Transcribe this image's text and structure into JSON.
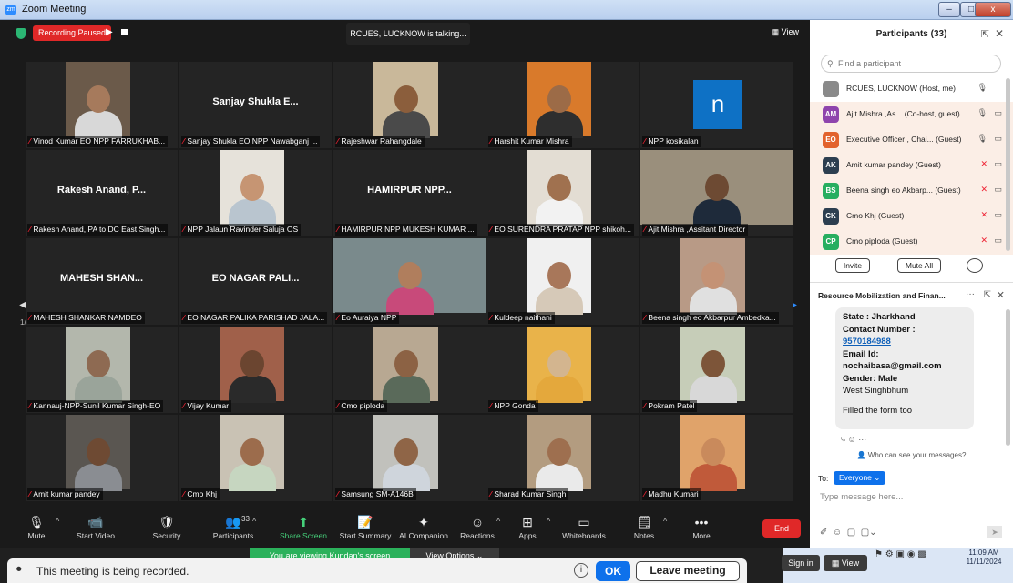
{
  "window": {
    "title": "Zoom Meeting",
    "min": "–",
    "max": "□",
    "close": "x"
  },
  "topbar": {
    "recording_status": "Recording Paused",
    "play": "▶",
    "talking": "RCUES, LUCKNOW is talking...",
    "view_label": "View"
  },
  "grid": {
    "page": "1/2",
    "tiles": [
      {
        "label": "Vinod Kumar EO NPP FARRUKHAB...",
        "big": "",
        "type": "cam",
        "skin": "#a67a5c",
        "shirt": "#d8d8d8",
        "bg": "#6b5a4a"
      },
      {
        "label": "Sanjay Shukla EO NPP Nawabganj ...",
        "big": "Sanjay Shukla E...",
        "type": "name"
      },
      {
        "label": "Rajeshwar Rahangdale",
        "big": "",
        "type": "cam",
        "skin": "#8b5e3c",
        "shirt": "#4a4a4a",
        "bg": "#c9b89a"
      },
      {
        "label": "Harshit Kumar Mishra",
        "big": "",
        "type": "cam",
        "skin": "#9c6b47",
        "shirt": "#2e2e2e",
        "bg": "#d97a2b"
      },
      {
        "label": "NPP kosikalan",
        "big": "n",
        "type": "logo"
      },
      {
        "label": "Rakesh Anand, PA to DC East Singh...",
        "big": "Rakesh Anand, P...",
        "type": "name"
      },
      {
        "label": "NPP Jalaun Ravinder Saluja OS",
        "big": "",
        "type": "cam",
        "skin": "#c69573",
        "shirt": "#b9c5cf",
        "bg": "#e6e2da"
      },
      {
        "label": "HAMIRPUR NPP MUKESH KUMAR ...",
        "big": "HAMIRPUR NPP...",
        "type": "name"
      },
      {
        "label": "EO SURENDRA PRATAP NPP shikoh...",
        "big": "",
        "type": "cam",
        "skin": "#a0714f",
        "shirt": "#f2f2f2",
        "bg": "#e3ddd3"
      },
      {
        "label": "Ajit Mishra ,Assitant Director",
        "big": "",
        "type": "wide",
        "skin": "#6d4a33",
        "shirt": "#1e2a3a",
        "bg": "#9a8f7c"
      },
      {
        "label": "MAHESH SHANKAR NAMDEO",
        "big": "MAHESH SHAN...",
        "type": "name"
      },
      {
        "label": "EO NAGAR PALIKA PARISHAD JALA...",
        "big": "EO NAGAR PALI...",
        "type": "name"
      },
      {
        "label": "Eo Auraiya NPP",
        "big": "",
        "type": "wide",
        "skin": "#b07e5d",
        "shirt": "#c84a7a",
        "bg": "#7a8a8c"
      },
      {
        "label": "Kuldeep naithani",
        "big": "",
        "type": "cam",
        "skin": "#a8775a",
        "shirt": "#d6c9b8",
        "bg": "#f0f0f0"
      },
      {
        "label": "Beena singh eo Akbarpur Ambedka...",
        "big": "",
        "type": "cam",
        "skin": "#c49275",
        "shirt": "#e0e0e0",
        "bg": "#b89a86"
      },
      {
        "label": "Kannauj-NPP-Sunil Kumar Singh-EO",
        "big": "",
        "type": "cam",
        "skin": "#8e6a52",
        "shirt": "#9aa49a",
        "bg": "#b3b7ac"
      },
      {
        "label": "Vijay Kumar",
        "big": "",
        "type": "cam",
        "skin": "#6b4530",
        "shirt": "#2a2a2a",
        "bg": "#a0604a"
      },
      {
        "label": "Cmo piploda",
        "big": "",
        "type": "cam",
        "skin": "#8c6244",
        "shirt": "#5a6a5a",
        "bg": "#b8a892"
      },
      {
        "label": "NPP Gonda",
        "big": "",
        "type": "cam",
        "skin": "#d3b58f",
        "shirt": "#e4a83c",
        "bg": "#e9b34a"
      },
      {
        "label": "Pokram Patel",
        "big": "",
        "type": "cam",
        "skin": "#7d5539",
        "shirt": "#d8d8d8",
        "bg": "#c6cdb8"
      },
      {
        "label": "Amit kumar pandey",
        "big": "",
        "type": "cam",
        "skin": "#6e4a33",
        "shirt": "#8a8d92",
        "bg": "#5a5651"
      },
      {
        "label": "Cmo Khj",
        "big": "",
        "type": "cam",
        "skin": "#9c6c4c",
        "shirt": "#c6d6c0",
        "bg": "#c9c2b4"
      },
      {
        "label": "Samsung SM-A146B",
        "big": "",
        "type": "cam",
        "skin": "#8f6547",
        "shirt": "#cfd5dc",
        "bg": "#c1c1bc"
      },
      {
        "label": "Sharad Kumar Singh",
        "big": "",
        "type": "cam",
        "skin": "#9e6f4f",
        "shirt": "#eaeaea",
        "bg": "#b39c80"
      },
      {
        "label": "Madhu Kumari",
        "big": "",
        "type": "cam",
        "skin": "#c98a5c",
        "shirt": "#c05a3a",
        "bg": "#e0a36a"
      }
    ]
  },
  "toolbar": {
    "items": [
      {
        "label": "Mute",
        "icon": "🎙"
      },
      {
        "label": "Start Video",
        "icon": "📹"
      },
      {
        "label": "Security",
        "icon": "🛡"
      },
      {
        "label": "Participants",
        "icon": "👥",
        "count": "33"
      },
      {
        "label": "Share Screen",
        "icon": "⬆"
      },
      {
        "label": "Start Summary",
        "icon": "📝"
      },
      {
        "label": "AI Companion",
        "icon": "✦"
      },
      {
        "label": "Reactions",
        "icon": "☺"
      },
      {
        "label": "Apps",
        "icon": "⊞"
      },
      {
        "label": "Whiteboards",
        "icon": "▭"
      },
      {
        "label": "Notes",
        "icon": "🗒"
      },
      {
        "label": "More",
        "icon": "•••"
      }
    ],
    "end": "End"
  },
  "participants": {
    "title": "Participants (33)",
    "search_placeholder": "Find a participant",
    "rows": [
      {
        "initials": "",
        "name": "RCUES, LUCKNOW (Host, me)",
        "color": "#8a8a8a",
        "mic": "🎙",
        "video": ""
      },
      {
        "initials": "AM",
        "name": "Ajit Mishra ,As...  (Co-host, guest)",
        "color": "#8e44ad",
        "mic": "🎙",
        "video": "▭"
      },
      {
        "initials": "EO",
        "name": "Executive Officer , Chai...  (Guest)",
        "color": "#e2622d",
        "mic": "🎙",
        "video": "▭"
      },
      {
        "initials": "AK",
        "name": "Amit kumar pandey (Guest)",
        "color": "#2c3e50",
        "mic": "✕",
        "video": "▭"
      },
      {
        "initials": "BS",
        "name": "Beena singh eo Akbarp...  (Guest)",
        "color": "#27ae60",
        "mic": "✕",
        "video": "▭"
      },
      {
        "initials": "CK",
        "name": "Cmo Khj (Guest)",
        "color": "#2c3e50",
        "mic": "✕",
        "video": "▭"
      },
      {
        "initials": "CP",
        "name": "Cmo piploda (Guest)",
        "color": "#27ae60",
        "mic": "✕",
        "video": "▭"
      }
    ],
    "invite": "Invite",
    "mute_all": "Mute All",
    "more": "···"
  },
  "chat": {
    "title": "Resource Mobilization and Finan...",
    "message": {
      "state": "State : Jharkhand",
      "contact_label": "Contact Number :",
      "phone": "9570184988",
      "email_label": "Email Id:",
      "email": "nochaibasa@gmail.com",
      "gender": "Gender: Male",
      "district": "West Singhbhum",
      "note": "Filled the form too"
    },
    "who_can_see": "Who can see your messages?",
    "to_label": "To:",
    "to_value": "Everyone",
    "input_placeholder": "Type message here..."
  },
  "notice": {
    "recording": "This meeting is being recorded.",
    "ok": "OK",
    "leave": "Leave meeting",
    "viewing": "You are viewing Kundan's screen",
    "view_options": "View Options",
    "sign_in": "Sign in",
    "view": "View"
  },
  "clock": {
    "time": "11:09 AM",
    "date": "11/11/2024"
  }
}
